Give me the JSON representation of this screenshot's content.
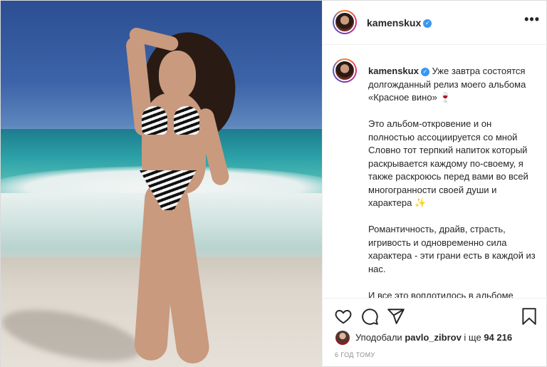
{
  "post": {
    "username": "kamenskux",
    "verified": true,
    "more_label": "•••",
    "caption": {
      "username": "kamenskux",
      "paragraphs": [
        "Уже завтра состоятся долгожданный релиз моего альбома «Красное вино» 🍷",
        "Это альбом-откровение и он полностью ассоциируется со мной Словно тот терпкий напиток который раскрывается каждому по-своему, я также раскроюсь перед вами во всей многогранности своей души и характера ✨",
        "Романтичность, драйв, страсть, игривость и одновременно сила характера - эти грани есть в каждой из нас.",
        "И все это воплотилось в альбоме «Красное вино»"
      ]
    },
    "likes": {
      "prefix": "Уподобали",
      "user": "pavlo_zibrov",
      "suffix": "і ще",
      "count": "94 216"
    },
    "timestamp": "6 год тому",
    "icons": {
      "like": "heart-icon",
      "comment": "comment-icon",
      "share": "share-icon",
      "save": "bookmark-icon",
      "verified": "verified-badge-icon"
    },
    "colors": {
      "verified": "#3897f0",
      "text": "#262626",
      "muted": "#8e8e8e"
    }
  }
}
